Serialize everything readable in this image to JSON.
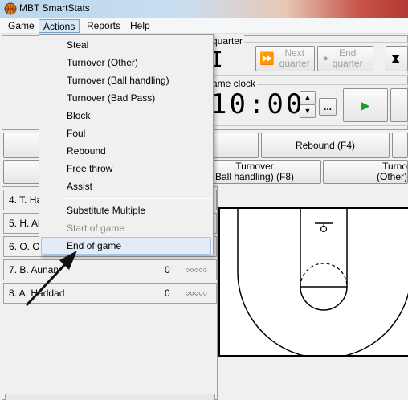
{
  "window": {
    "title": "MBT SmartStats"
  },
  "menubar": {
    "items": [
      "Game",
      "Actions",
      "Reports",
      "Help"
    ]
  },
  "quarter": {
    "label": "quarter",
    "value": "I",
    "next_label": "Next quarter",
    "end_label": "End quarter"
  },
  "clock": {
    "label": "ame clock",
    "value": "10:00",
    "more_label": "..."
  },
  "actions_row1": {
    "rebound": "Rebound (F4)"
  },
  "actions_row2": {
    "turnover_bh_line1": "Turnover",
    "turnover_bh_line2": "Ball handling) (F8)",
    "turnover_other_line1": "Turno",
    "turnover_other_line2": "(Other)"
  },
  "players": [
    {
      "name": "4. T. Ha",
      "fouls": "",
      "dots": ""
    },
    {
      "name": "5. H. Al",
      "fouls": "",
      "dots": ""
    },
    {
      "name": "6. O. Ol",
      "fouls": "",
      "dots": ""
    },
    {
      "name": "7. B. Aunan",
      "fouls": "0",
      "dots": "○○○○○"
    },
    {
      "name": "8. A. Haddad",
      "fouls": "0",
      "dots": "○○○○○"
    }
  ],
  "actions_menu": {
    "items": [
      {
        "label": "Steal",
        "enabled": true
      },
      {
        "label": "Turnover (Other)",
        "enabled": true
      },
      {
        "label": "Turnover (Ball handling)",
        "enabled": true
      },
      {
        "label": "Turnover (Bad Pass)",
        "enabled": true
      },
      {
        "label": "Block",
        "enabled": true
      },
      {
        "label": "Foul",
        "enabled": true
      },
      {
        "label": "Rebound",
        "enabled": true
      },
      {
        "label": "Free throw",
        "enabled": true
      },
      {
        "label": "Assist",
        "enabled": true
      },
      {
        "label": "Substitute Multiple",
        "enabled": true
      },
      {
        "label": "Start of game",
        "enabled": false
      },
      {
        "label": "End of game",
        "enabled": true,
        "highlighted": true
      }
    ]
  },
  "colors": {
    "menu_highlight": "#e2ebf6",
    "play_green": "#1c9c2a",
    "arrow": "#111111"
  }
}
